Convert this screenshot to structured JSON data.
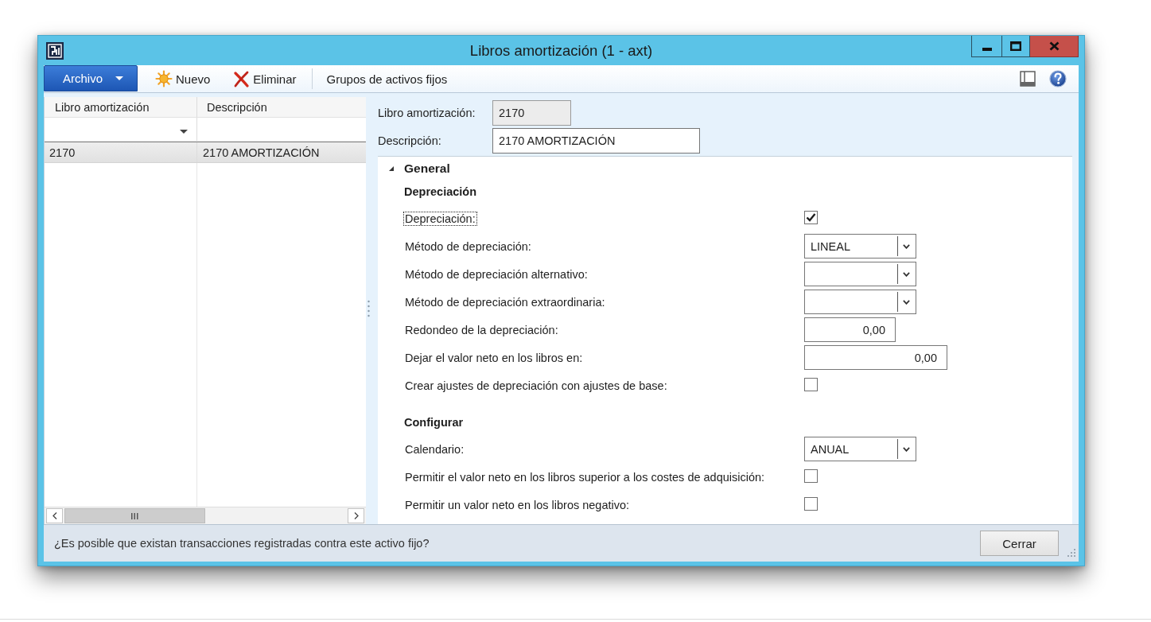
{
  "window": {
    "title": "Libros amortización (1 - axt)"
  },
  "toolbar": {
    "file_menu": "Archivo",
    "buttons": [
      {
        "kind": "new",
        "label": "Nuevo"
      },
      {
        "kind": "delete",
        "label": "Eliminar"
      },
      {
        "kind": "text",
        "label": "Grupos de activos fijos"
      }
    ]
  },
  "grid": {
    "columns": [
      "Libro amortización",
      "Descripción"
    ],
    "rows": [
      {
        "cells": [
          "2170",
          "2170 AMORTIZACIÓN"
        ],
        "selected": true
      }
    ]
  },
  "header_fields": [
    {
      "label": "Libro amortización:",
      "value": "2170",
      "disabled": true
    },
    {
      "label": "Descripción:",
      "value": "2170 AMORTIZACIÓN",
      "disabled": false
    }
  ],
  "section": {
    "title": "General",
    "expanded": true,
    "groups": [
      {
        "title": "Depreciación",
        "fields": [
          {
            "kind": "checkbox",
            "label": "Depreciación:",
            "checked": true,
            "focused": true
          },
          {
            "kind": "dropdown",
            "label": "Método de depreciación:",
            "value": "LINEAL",
            "focused": false
          },
          {
            "kind": "dropdown",
            "label": "Método de depreciación alternativo:",
            "focused": false
          },
          {
            "kind": "dropdown",
            "label": "Método de depreciación extraordinaria:",
            "focused": false
          },
          {
            "kind": "real",
            "label": "Redondeo de la depreciación:",
            "value": "0,00",
            "focused": false
          },
          {
            "kind": "amount",
            "label": "Dejar el valor neto en los libros en:",
            "value": "0,00",
            "focused": false
          },
          {
            "kind": "checkbox",
            "label": "Crear ajustes de depreciación con ajustes de base:",
            "checked": false,
            "focused": false
          }
        ]
      },
      {
        "title": "Configurar",
        "fields": [
          {
            "kind": "dropdown",
            "label": "Calendario:",
            "value": "ANUAL",
            "focused": false
          },
          {
            "kind": "checkbox",
            "label": "Permitir el valor neto en los libros superior a los costes de adquisición:",
            "checked": false,
            "focused": false
          },
          {
            "kind": "checkbox",
            "label": "Permitir un valor neto en los libros negativo:",
            "checked": false,
            "focused": false
          }
        ]
      }
    ]
  },
  "status_bar": {
    "message": "¿Es posible que existan transacciones registradas contra este activo fijo?",
    "button": "Cerrar"
  }
}
